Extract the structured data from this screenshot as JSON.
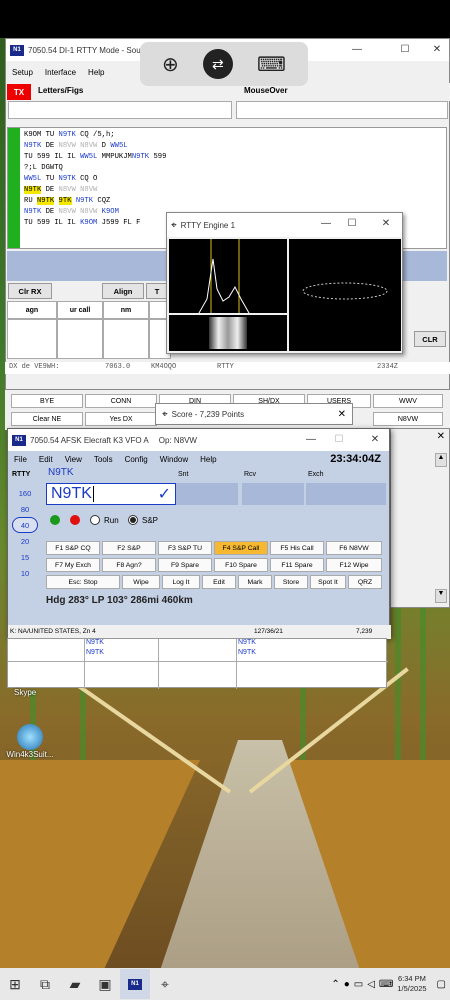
{
  "main_window": {
    "title": "7050.54 DI-1 RTTY Mode - Sou",
    "menu": [
      "Setup",
      "Interface",
      "Help"
    ],
    "tx_label": "TX",
    "letters_figs": "Letters/Figs",
    "mouseover": "MouseOver",
    "rx_lines": [
      {
        "parts": [
          {
            "t": "K9OM TU ",
            "c": ""
          },
          {
            "t": "N9TK",
            "c": "blue"
          },
          {
            "t": " CQ /5,h;",
            "c": ""
          }
        ]
      },
      {
        "parts": [
          {
            "t": "N9TK",
            "c": "blue"
          },
          {
            "t": " DE ",
            "c": ""
          },
          {
            "t": "N8VW N8VW",
            "c": "faint"
          },
          {
            "t": " D ",
            "c": ""
          },
          {
            "t": "WW5L",
            "c": "blue"
          }
        ]
      },
      {
        "parts": [
          {
            "t": "TU 599 IL IL ",
            "c": ""
          },
          {
            "t": "WW5L",
            "c": "blue"
          },
          {
            "t": " MMPUKJM",
            "c": ""
          },
          {
            "t": "N9TK",
            "c": "blue"
          },
          {
            "t": " 599",
            "c": ""
          }
        ]
      },
      {
        "parts": [
          {
            "t": "?;L DGWTQ",
            "c": ""
          }
        ]
      },
      {
        "parts": [
          {
            "t": "WW5L",
            "c": "blue"
          },
          {
            "t": " TU ",
            "c": ""
          },
          {
            "t": "N9TK",
            "c": "blue"
          },
          {
            "t": " CQ O",
            "c": ""
          }
        ]
      },
      {
        "parts": [
          {
            "t": "N9TK",
            "c": "hl"
          },
          {
            "t": " DE ",
            "c": ""
          },
          {
            "t": "N8VW N8VW",
            "c": "faint"
          }
        ]
      },
      {
        "parts": [
          {
            "t": "RU ",
            "c": ""
          },
          {
            "t": "N9TK",
            "c": "hl"
          },
          {
            "t": " ",
            "c": ""
          },
          {
            "t": "9TK",
            "c": "hl"
          },
          {
            "t": " ",
            "c": ""
          },
          {
            "t": "N9TK",
            "c": "blue"
          },
          {
            "t": " CQZ",
            "c": ""
          }
        ]
      },
      {
        "parts": [
          {
            "t": "N9TK",
            "c": "blue"
          },
          {
            "t": " DE ",
            "c": ""
          },
          {
            "t": "N8VW N8VW",
            "c": "faint"
          },
          {
            "t": " K9OM",
            "c": "blue"
          }
        ]
      },
      {
        "parts": [
          {
            "t": "TU 599 IL IL ",
            "c": ""
          },
          {
            "t": "K9OM",
            "c": "blue"
          },
          {
            "t": " J599 FL F",
            "c": ""
          }
        ]
      }
    ],
    "clr_rx": "Clr RX",
    "align": "Align",
    "tx_short": "T",
    "clr": "CLR",
    "grid_headers": [
      "agn",
      "ur call",
      "nm"
    ]
  },
  "dx_spot": {
    "text": "DX de VE9WH:",
    "freq": "7063.0",
    "call": "KM4OQO",
    "mode": "RTTY",
    "time": "2334Z"
  },
  "telnet_buttons": [
    "BYE",
    "CONN",
    "DIN",
    "SH/DX",
    "USERS",
    "WWV",
    "Clear NE",
    "Yes DX",
    "N8VW"
  ],
  "rtty_engine": {
    "title": "RTTY Engine 1"
  },
  "score": {
    "title": "Score - 7,239 Points"
  },
  "entry_window": {
    "title": "7050.54 AFSK Elecraft K3 VFO A",
    "op": "Op: N8VW",
    "menu": [
      "File",
      "Edit",
      "View",
      "Tools",
      "Config",
      "Window",
      "Help"
    ],
    "clock": "23:34:04Z",
    "mode_label": "RTTY",
    "call_hint": "N9TK",
    "call_value": "N9TK",
    "checkmark": "✓",
    "col_snt": "Snt",
    "col_rcv": "Rcv",
    "col_exch": "Exch",
    "bands": [
      "160",
      "80",
      "40",
      "20",
      "15",
      "10"
    ],
    "selected_band": "40",
    "run_label": "Run",
    "sp_label": "S&P",
    "fkeys": [
      [
        "F1 S&P CQ",
        "F2 S&P",
        "F3 S&P TU",
        "F4 S&P Call",
        "F5 His Call",
        "F6 N8VW"
      ],
      [
        "F7 My Exch",
        "F8 Agn?",
        "F9 Spare",
        "F10 Spare",
        "F11 Spare",
        "F12 Wipe"
      ],
      [
        "Esc: Stop",
        "Wipe",
        "Log It",
        "Edit",
        "Mark",
        "Store",
        "Spot It",
        "QRZ"
      ]
    ],
    "heading": "Hdg 283°  LP 103°  286mi 460km",
    "status_left": "K: NA/UNITED STATES, Zn 4",
    "status_mid": "127/36/21",
    "status_right": "7,239"
  },
  "bandmap": {
    "entries": [
      "N9TK",
      "N9TK",
      "N9TK",
      "N9TK"
    ]
  },
  "desktop_icons": {
    "skype": "Skype",
    "win4k3": "Win4k3Suit..."
  },
  "taskbar": {
    "time": "6:34 PM",
    "date": "1/5/2025"
  }
}
